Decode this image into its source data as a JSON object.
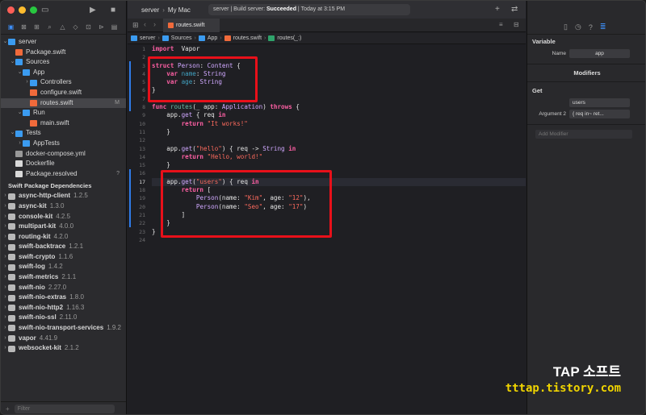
{
  "window": {
    "title": "server"
  },
  "toolbar": {
    "scheme": "server",
    "destination": "My Mac",
    "status_prefix": "server | Build server: ",
    "status_result": "Succeeded",
    "status_time": " | Today at 3:15 PM"
  },
  "tab": {
    "label": "routes.swift"
  },
  "jumpbar": [
    "server",
    "Sources",
    "App",
    "routes.swift",
    "routes(_:)"
  ],
  "navigator": {
    "tree": [
      {
        "label": "server",
        "icon": "project",
        "depth": 0,
        "chev": "v"
      },
      {
        "label": "Package.swift",
        "icon": "swift",
        "depth": 1,
        "chev": ""
      },
      {
        "label": "Sources",
        "icon": "folder",
        "depth": 1,
        "chev": "v"
      },
      {
        "label": "App",
        "icon": "folder",
        "depth": 2,
        "chev": "v"
      },
      {
        "label": "Controllers",
        "icon": "folder",
        "depth": 3,
        "chev": ">"
      },
      {
        "label": "configure.swift",
        "icon": "swift",
        "depth": 3,
        "chev": ""
      },
      {
        "label": "routes.swift",
        "icon": "swift",
        "depth": 3,
        "chev": "",
        "selected": true,
        "badge": "M"
      },
      {
        "label": "Run",
        "icon": "folder",
        "depth": 2,
        "chev": "v"
      },
      {
        "label": "main.swift",
        "icon": "swift",
        "depth": 3,
        "chev": ""
      },
      {
        "label": "Tests",
        "icon": "folder",
        "depth": 1,
        "chev": "v"
      },
      {
        "label": "AppTests",
        "icon": "folder",
        "depth": 2,
        "chev": ">"
      },
      {
        "label": "docker-compose.yml",
        "icon": "file",
        "depth": 1,
        "chev": ""
      },
      {
        "label": "Dockerfile",
        "icon": "doc",
        "depth": 1,
        "chev": ""
      },
      {
        "label": "Package.resolved",
        "icon": "doc",
        "depth": 1,
        "chev": "",
        "badge": "?"
      }
    ],
    "packages_header": "Swift Package Dependencies",
    "packages": [
      {
        "name": "async-http-client",
        "version": "1.2.5"
      },
      {
        "name": "async-kit",
        "version": "1.3.0"
      },
      {
        "name": "console-kit",
        "version": "4.2.5"
      },
      {
        "name": "multipart-kit",
        "version": "4.0.0"
      },
      {
        "name": "routing-kit",
        "version": "4.2.0"
      },
      {
        "name": "swift-backtrace",
        "version": "1.2.1"
      },
      {
        "name": "swift-crypto",
        "version": "1.1.6"
      },
      {
        "name": "swift-log",
        "version": "1.4.2"
      },
      {
        "name": "swift-metrics",
        "version": "2.1.1"
      },
      {
        "name": "swift-nio",
        "version": "2.27.0"
      },
      {
        "name": "swift-nio-extras",
        "version": "1.8.0"
      },
      {
        "name": "swift-nio-http2",
        "version": "1.16.3"
      },
      {
        "name": "swift-nio-ssl",
        "version": "2.11.0"
      },
      {
        "name": "swift-nio-transport-services",
        "version": "1.9.2"
      },
      {
        "name": "vapor",
        "version": "4.41.9"
      },
      {
        "name": "websocket-kit",
        "version": "2.1.2"
      }
    ],
    "filter_placeholder": "Filter"
  },
  "editor": {
    "current_line": 17,
    "lines": [
      [
        [
          "kw",
          "import"
        ],
        [
          "",
          "  Vapor"
        ]
      ],
      [],
      [
        [
          "kw",
          "struct"
        ],
        [
          "",
          " "
        ],
        [
          "ty",
          "Person"
        ],
        [
          "",
          ": "
        ],
        [
          "ty",
          "Content"
        ],
        [
          "",
          " {"
        ]
      ],
      [
        [
          "",
          "    "
        ],
        [
          "kw",
          "var"
        ],
        [
          "",
          " "
        ],
        [
          "id",
          "name"
        ],
        [
          "",
          ": "
        ],
        [
          "ty",
          "String"
        ]
      ],
      [
        [
          "",
          "    "
        ],
        [
          "kw",
          "var"
        ],
        [
          "",
          " "
        ],
        [
          "id",
          "age"
        ],
        [
          "",
          ": "
        ],
        [
          "ty",
          "String"
        ]
      ],
      [
        [
          "",
          "}"
        ]
      ],
      [],
      [
        [
          "kw",
          "func"
        ],
        [
          "",
          " "
        ],
        [
          "fn",
          "routes"
        ],
        [
          "",
          "(_ app: "
        ],
        [
          "ty",
          "Application"
        ],
        [
          "",
          ") "
        ],
        [
          "kw",
          "throws"
        ],
        [
          "",
          " {"
        ]
      ],
      [
        [
          "",
          "    app."
        ],
        [
          "ty",
          "get"
        ],
        [
          "",
          " { req "
        ],
        [
          "kw",
          "in"
        ]
      ],
      [
        [
          "",
          "        "
        ],
        [
          "kw",
          "return"
        ],
        [
          "",
          " "
        ],
        [
          "st",
          "\"It works!\""
        ]
      ],
      [
        [
          "",
          "    }"
        ]
      ],
      [],
      [
        [
          "",
          "    app."
        ],
        [
          "ty",
          "get"
        ],
        [
          "",
          "("
        ],
        [
          "st",
          "\"hello\""
        ],
        [
          "",
          ") { req -> "
        ],
        [
          "ty",
          "String"
        ],
        [
          "",
          " "
        ],
        [
          "kw",
          "in"
        ]
      ],
      [
        [
          "",
          "        "
        ],
        [
          "kw",
          "return"
        ],
        [
          "",
          " "
        ],
        [
          "st",
          "\"Hello, world!\""
        ]
      ],
      [
        [
          "",
          "    }"
        ]
      ],
      [],
      [
        [
          "",
          "    app."
        ],
        [
          "ty",
          "get"
        ],
        [
          "",
          "("
        ],
        [
          "st",
          "\"users\""
        ],
        [
          "",
          ") { req "
        ],
        [
          "kw",
          "in"
        ]
      ],
      [
        [
          "",
          "        "
        ],
        [
          "kw",
          "return"
        ],
        [
          "",
          " ["
        ]
      ],
      [
        [
          "",
          "            "
        ],
        [
          "ty",
          "Person"
        ],
        [
          "",
          "(name: "
        ],
        [
          "st",
          "\"Kim\""
        ],
        [
          "",
          ", age: "
        ],
        [
          "st",
          "\"12\""
        ],
        [
          "",
          "),"
        ]
      ],
      [
        [
          "",
          "            "
        ],
        [
          "ty",
          "Person"
        ],
        [
          "",
          "(name: "
        ],
        [
          "st",
          "\"Seo\""
        ],
        [
          "",
          ", age: "
        ],
        [
          "st",
          "\"17\""
        ],
        [
          "",
          ")"
        ]
      ],
      [
        [
          "",
          "        ]"
        ]
      ],
      [
        [
          "",
          "    }"
        ]
      ],
      [
        [
          "",
          "}"
        ]
      ],
      []
    ]
  },
  "inspector": {
    "variable_section": "Variable",
    "name_label": "Name",
    "name_value": "app",
    "modifiers_section": "Modifiers",
    "get_section": "Get",
    "get_arg1": "users",
    "arg2_label": "Argument 2",
    "arg2_value": "{ req in~ ret...",
    "add_modifier": "Add Modifier"
  },
  "watermark": {
    "line1": "TAP 소프트",
    "line2": "tttap.tistory.com"
  },
  "colors": {
    "keyword": "#fc5fa3",
    "type": "#d0a8ff",
    "string": "#fc6a5d",
    "highlight_box": "#e8101a",
    "accent": "#3d8ef7"
  }
}
